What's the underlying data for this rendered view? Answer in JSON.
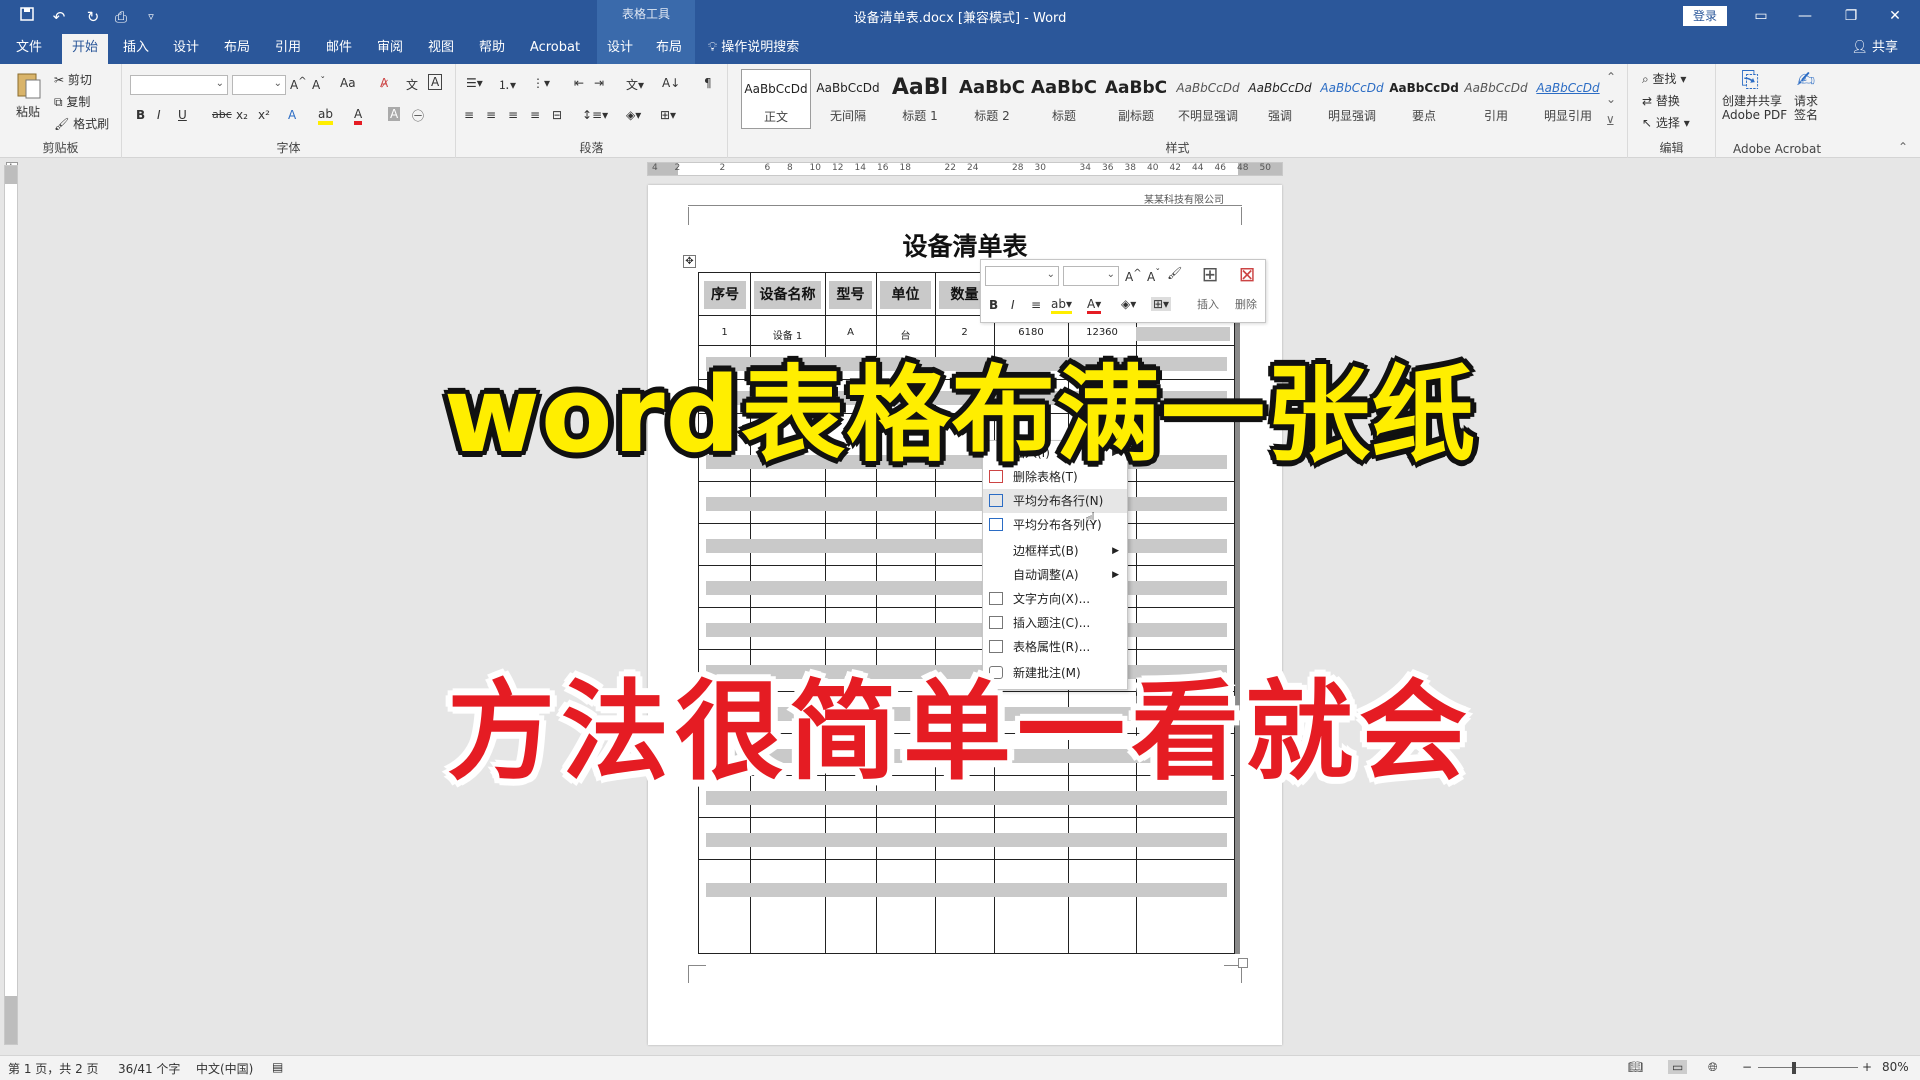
{
  "titlebar": {
    "doc_title": "设备清单表.docx [兼容模式] - Word",
    "context_tool": "表格工具",
    "login": "登录",
    "quick_access": [
      "save-icon",
      "undo-icon",
      "redo-icon",
      "print-preview-icon",
      "customize-icon"
    ]
  },
  "tabs": [
    {
      "label": "文件"
    },
    {
      "label": "开始"
    },
    {
      "label": "插入"
    },
    {
      "label": "设计"
    },
    {
      "label": "布局"
    },
    {
      "label": "引用"
    },
    {
      "label": "邮件"
    },
    {
      "label": "审阅"
    },
    {
      "label": "视图"
    },
    {
      "label": "帮助"
    },
    {
      "label": "Acrobat"
    },
    {
      "label": "设计"
    },
    {
      "label": "布局"
    }
  ],
  "tell_me": "操作说明搜索",
  "share": "共享",
  "ribbon": {
    "clipboard": {
      "paste": "粘贴",
      "cut": "剪切",
      "copy": "复制",
      "format_painter": "格式刷",
      "label": "剪贴板"
    },
    "font": {
      "label": "字体",
      "aa": "Aa",
      "bold": "B",
      "italic": "I",
      "underline": "U",
      "strike": "abc",
      "sub": "x₂",
      "sup": "x²"
    },
    "paragraph": {
      "label": "段落"
    },
    "styles": {
      "label": "样式",
      "items": [
        {
          "sample": "AaBbCcDd",
          "name": "正文"
        },
        {
          "sample": "AaBbCcDd",
          "name": "无间隔"
        },
        {
          "sample": "AaBl",
          "name": "标题 1"
        },
        {
          "sample": "AaBbC",
          "name": "标题 2"
        },
        {
          "sample": "AaBbC",
          "name": "标题"
        },
        {
          "sample": "AaBbC",
          "name": "副标题"
        },
        {
          "sample": "AaBbCcDd",
          "name": "不明显强调"
        },
        {
          "sample": "AaBbCcDd",
          "name": "强调"
        },
        {
          "sample": "AaBbCcDd",
          "name": "明显强调"
        },
        {
          "sample": "AaBbCcDd",
          "name": "要点"
        },
        {
          "sample": "AaBbCcDd",
          "name": "引用"
        },
        {
          "sample": "AaBbCcDd",
          "name": "明显引用"
        }
      ]
    },
    "editing": {
      "find": "查找",
      "replace": "替换",
      "select": "选择",
      "label": "编辑"
    },
    "acrobat": {
      "create": "创建并共享",
      "create2": "Adobe PDF",
      "sign": "请求",
      "sign2": "签名",
      "label": "Adobe Acrobat"
    }
  },
  "ruler": {
    "numbers": [
      "4",
      "2",
      "",
      "2",
      "",
      "6",
      "8",
      "10",
      "12",
      "14",
      "16",
      "18",
      "",
      "22",
      "24",
      "",
      "28",
      "30",
      "",
      "34",
      "36",
      "38",
      "40",
      "42",
      "44",
      "46",
      "48",
      "50"
    ]
  },
  "page": {
    "company": "某某科技有限公司",
    "title": "设备清单表"
  },
  "table": {
    "headers": [
      "序号",
      "设备名称",
      "型号",
      "单位",
      "数量"
    ],
    "row1": [
      "1",
      "设备 1",
      "A",
      "台",
      "2",
      "6180",
      "12360"
    ]
  },
  "mini_toolbar": {
    "insert": "插入",
    "delete": "删除"
  },
  "context_menu": [
    {
      "label": "插入(I)",
      "icon": "",
      "submenu": true
    },
    {
      "label": "删除表格(T)",
      "icon": "delete-table-icon",
      "submenu": false
    },
    {
      "label": "平均分布各行(N)",
      "icon": "distribute-rows-icon",
      "submenu": false
    },
    {
      "label": "平均分布各列(Y)",
      "icon": "distribute-columns-icon",
      "submenu": false
    },
    {
      "label": "边框样式(B)",
      "icon": "",
      "submenu": true
    },
    {
      "label": "自动调整(A)",
      "icon": "",
      "submenu": true
    },
    {
      "label": "文字方向(X)...",
      "icon": "text-direction-icon",
      "submenu": false
    },
    {
      "label": "插入题注(C)...",
      "icon": "caption-icon",
      "submenu": false
    },
    {
      "label": "表格属性(R)...",
      "icon": "table-properties-icon",
      "submenu": false
    },
    {
      "label": "新建批注(M)",
      "icon": "comment-icon",
      "submenu": false
    }
  ],
  "status": {
    "page": "第 1 页，共 2 页",
    "words": "36/41 个字",
    "lang": "中文(中国)",
    "zoom": "80%"
  },
  "overlay": {
    "line1": "word表格布满一张纸",
    "line2": "方法很简单一看就会",
    "line1_color": "#ffee00",
    "line2_color": "#e51c23"
  }
}
